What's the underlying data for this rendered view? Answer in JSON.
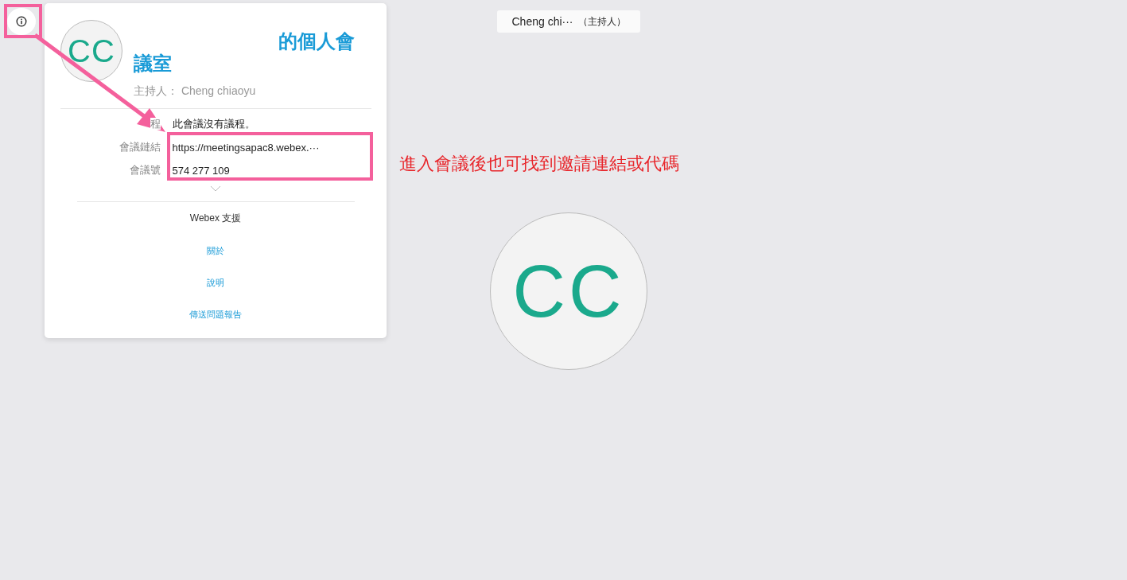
{
  "meeting_info_button": {
    "kind": "info"
  },
  "info_card": {
    "initials": "CC",
    "title": "的個人會議室",
    "host": "主持人： Cheng chiaoyu",
    "details": [
      {
        "label": "程",
        "value": "此會議沒有議程。"
      },
      {
        "label": "會議鏈結",
        "value": "https://meetingsapac8.webex.···"
      },
      {
        "label": "會議號",
        "value": "574 277 109"
      }
    ],
    "support_title": "Webex 支援",
    "support_links": [
      "關於",
      "說明",
      "傳送問題報告"
    ]
  },
  "participant_tag": {
    "name": "Cheng chi···",
    "role": "（主持人）"
  },
  "participant_avatar": {
    "initials": "CC"
  },
  "annotation": {
    "text": "進入會議後也可找到邀請連結或代碼"
  }
}
